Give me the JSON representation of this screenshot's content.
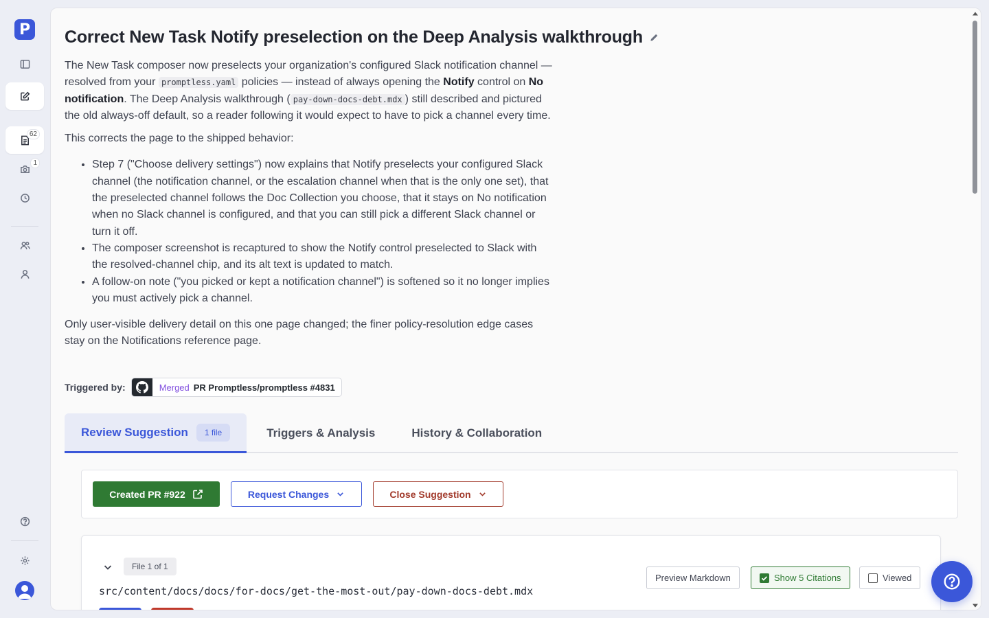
{
  "app": {
    "logo_letter": "P",
    "accent": "#3b57d9"
  },
  "sidebar": {
    "items": [
      {
        "name": "toggle-sidebar",
        "icon": "sidebar-panel-icon"
      },
      {
        "name": "new-task",
        "icon": "edit-square-icon",
        "active": true
      },
      {
        "name": "suggestions",
        "icon": "list-doc-icon",
        "badge": "62"
      },
      {
        "name": "screenshots",
        "icon": "camera-icon",
        "badge": "1"
      },
      {
        "name": "history",
        "icon": "clock-icon"
      },
      {
        "name": "team",
        "icon": "users-icon"
      },
      {
        "name": "profile",
        "icon": "user-icon"
      },
      {
        "name": "help",
        "icon": "question-circle-icon"
      },
      {
        "name": "settings",
        "icon": "gear-icon"
      }
    ]
  },
  "page": {
    "title": "Correct New Task Notify preselection on the Deep Analysis walkthrough",
    "desc": {
      "p1_a": "The New Task composer now preselects your organization's configured Slack notification channel — resolved from your ",
      "p1_code1": "promptless.yaml",
      "p1_b": " policies — instead of always opening the ",
      "p1_bold1": "Notify",
      "p1_c": " control on ",
      "p1_bold2": "No notification",
      "p1_d": ". The Deep Analysis walkthrough (",
      "p1_code2": "pay-down-docs-debt.mdx",
      "p1_e": ") still described and pictured the old always-off default, so a reader following it would expect to have to pick a channel every time.",
      "p2": "This corrects the page to the shipped behavior:",
      "bullets": [
        "Step 7 (\"Choose delivery settings\") now explains that Notify preselects your configured Slack channel (the notification channel, or the escalation channel when that is the only one set), that the preselected channel follows the Doc Collection you choose, that it stays on No notification when no Slack channel is configured, and that you can still pick a different Slack channel or turn it off.",
        "The composer screenshot is recaptured to show the Notify control preselected to Slack with the resolved-channel chip, and its alt text is updated to match.",
        "A follow-on note (\"you picked or kept a notification channel\") is softened so it no longer implies you must actively pick a channel."
      ],
      "p3": "Only user-visible delivery detail on this one page changed; the finer policy-resolution edge cases stay on the Notifications reference page."
    },
    "triggered": {
      "label": "Triggered by:",
      "status": "Merged",
      "pr": "PR Promptless/promptless #4831"
    }
  },
  "tabs": [
    {
      "label": "Review Suggestion",
      "pill": "1 file",
      "active": true
    },
    {
      "label": "Triggers & Analysis"
    },
    {
      "label": "History & Collaboration"
    }
  ],
  "actions": {
    "created_pr": "Created PR #922",
    "request_changes": "Request Changes",
    "close_suggestion": "Close Suggestion"
  },
  "file": {
    "count": "File 1 of 1",
    "path": "src/content/docs/docs/for-docs/get-the-most-out/pay-down-docs-debt.mdx",
    "preview": "Preview Markdown",
    "citations": "Show 5 Citations",
    "viewed": "Viewed"
  }
}
